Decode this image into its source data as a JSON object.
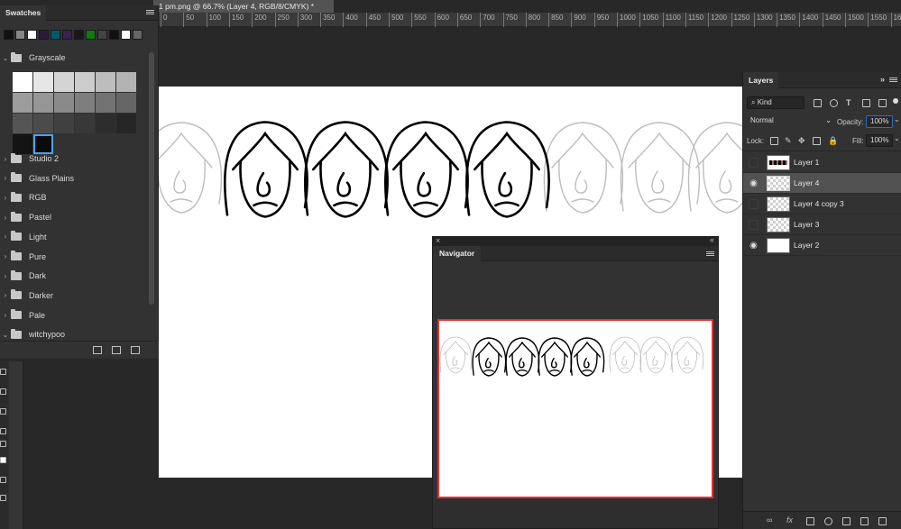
{
  "document": {
    "tab_title": "1 pm.png @ 66.7% (Layer 4, RGB/8/CMYK) *"
  },
  "ruler": {
    "ticks": [
      "0",
      "50",
      "100",
      "150",
      "200",
      "250",
      "300",
      "350",
      "400",
      "450",
      "500",
      "550",
      "600",
      "650",
      "700",
      "750",
      "800",
      "850",
      "900",
      "950",
      "1000",
      "1050",
      "1100",
      "1150",
      "1200",
      "1250",
      "1300",
      "1350",
      "1400",
      "1450",
      "1500",
      "1550",
      "16"
    ]
  },
  "swatches_panel": {
    "title": "Swatches",
    "recent_colors": [
      "#111111",
      "#888888",
      "#ffffff",
      "#2b1b3a",
      "#005a6e",
      "#3d2050",
      "#181818",
      "#0f7a0f",
      "#444444",
      "#111111",
      "#ffffff",
      "#666666"
    ],
    "grayscale_group": {
      "label": "Grayscale",
      "colors": [
        "#ffffff",
        "#e6e6e6",
        "#d4d4d4",
        "#cccccc",
        "#bdbdbd",
        "#b3b3b3",
        "#9d9d9d",
        "#969696",
        "#8a8a8a",
        "#7e7e7e",
        "#727272",
        "#666666",
        "#555555",
        "#4b4b4b",
        "#404040",
        "#383838",
        "#2d2d2d",
        "#262626",
        "#141414",
        "#0a0a0a"
      ]
    },
    "groups": [
      "Studio 2",
      "Glass Plains",
      "RGB",
      "Pastel",
      "Light",
      "Pure",
      "Dark",
      "Darker",
      "Pale",
      "witchypoo"
    ]
  },
  "layers_panel": {
    "title": "Layers",
    "filter_label": "Kind",
    "blend_mode": "Normal",
    "opacity_label": "Opacity:",
    "opacity_value": "100%",
    "lock_label": "Lock:",
    "fill_label": "Fill:",
    "fill_value": "100%",
    "layers": [
      {
        "name": "Layer 1",
        "visible": false,
        "selected": false,
        "thumb": "strip"
      },
      {
        "name": "Layer 4",
        "visible": true,
        "selected": true,
        "thumb": "checker"
      },
      {
        "name": "Layer 4 copy 3",
        "visible": false,
        "selected": false,
        "thumb": "checker"
      },
      {
        "name": "Layer 3",
        "visible": false,
        "selected": false,
        "thumb": "checker"
      },
      {
        "name": "Layer 2",
        "visible": true,
        "selected": false,
        "thumb": "white"
      }
    ]
  },
  "navigator_panel": {
    "title": "Navigator"
  },
  "colors": {
    "selection_outline": "#4aa3f7",
    "navigator_viewbox": "#e03232",
    "sketch_gray": "#bdbdbd",
    "ink": "#000000"
  }
}
